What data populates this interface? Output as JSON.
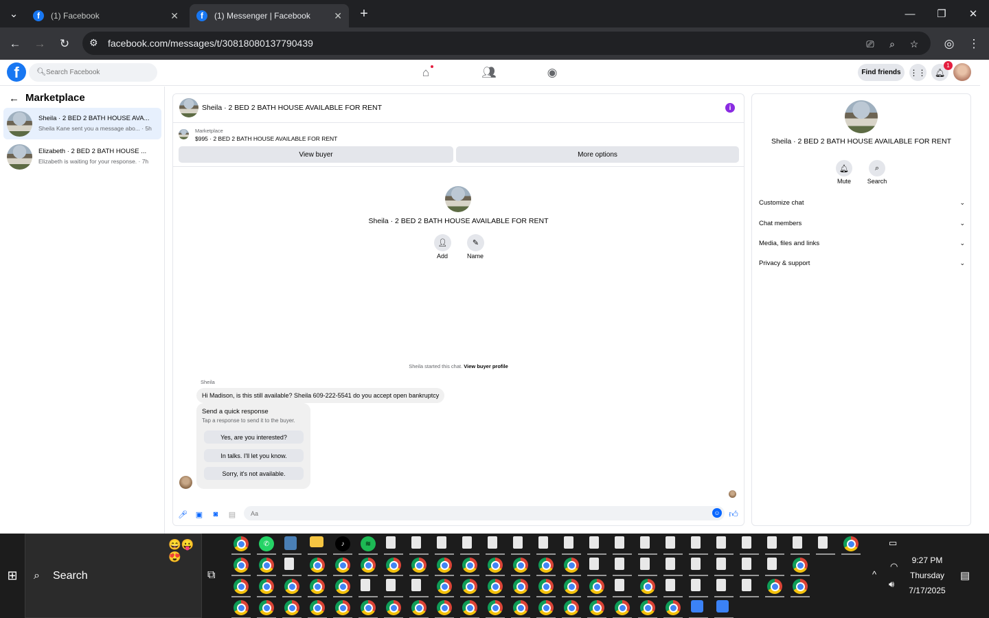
{
  "browser": {
    "tabs": [
      {
        "label": "(1) Facebook",
        "active": false
      },
      {
        "label": "(1) Messenger | Facebook",
        "active": true
      }
    ],
    "url": "facebook.com/messages/t/30818080137790439",
    "window_controls": [
      "minimize-icon",
      "restore-icon",
      "close-icon"
    ]
  },
  "fb": {
    "search_placeholder": "Search Facebook",
    "find_friends": "Find friends",
    "notifications_count": "1"
  },
  "sidebar": {
    "title": "Marketplace",
    "conversations": [
      {
        "name": "Sheila · 2 BED 2 BATH HOUSE AVA...",
        "preview": "Sheila Kane sent you a message abo... · 5h",
        "active": true
      },
      {
        "name": "Elizabeth · 2 BED 2 BATH HOUSE ...",
        "preview": "Elizabeth is waiting for your response. · 7h",
        "active": false
      }
    ]
  },
  "chat": {
    "title": "Sheila · 2 BED 2 BATH HOUSE AVAILABLE FOR RENT",
    "marketplace_label": "Marketplace",
    "listing": "$995 · 2 BED 2 BATH HOUSE AVAILABLE FOR RENT",
    "view_buyer": "View buyer",
    "more_options": "More options",
    "profile_name": "Sheila · 2 BED 2 BATH HOUSE AVAILABLE FOR RENT",
    "add_label": "Add",
    "name_label": "Name",
    "started_text": "Sheila started this chat.",
    "view_profile": "View buyer profile",
    "sender": "Sheila",
    "message": "Hi Madison, is this still available? Sheila 609-222-5541 do you accept open bankruptcy",
    "quick_title": "Send a quick response",
    "quick_sub": "Tap a response to send it to the buyer.",
    "quick_replies": [
      "Yes, are you interested?",
      "In talks. I'll let you know.",
      "Sorry, it's not available."
    ],
    "input_placeholder": "Aa"
  },
  "details": {
    "name": "Sheila · 2 BED 2 BATH HOUSE AVAILABLE FOR RENT",
    "mute": "Mute",
    "search": "Search",
    "sections": [
      "Customize chat",
      "Chat members",
      "Media, files and links",
      "Privacy & support"
    ]
  },
  "taskbar": {
    "search": "Search",
    "time": "9:27 PM",
    "day": "Thursday",
    "date": "7/17/2025"
  }
}
